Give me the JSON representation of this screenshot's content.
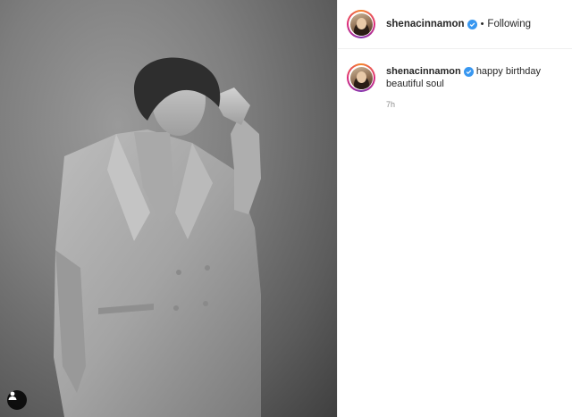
{
  "post": {
    "author": "shenacinnamon",
    "follow_status": "Following",
    "separator": "•",
    "caption_author": "shenacinnamon",
    "caption_text": "happy birthday beautiful soul",
    "timestamp": "7h",
    "photo": "black-and-white portrait of a person in a double-breasted suit, hand raised to hair"
  },
  "icons": {
    "verified": "verified-badge-icon",
    "tagged_users": "user-tag-icon"
  },
  "colors": {
    "verified_blue": "#3897f0",
    "border": "#efefef",
    "muted_text": "#8e8e8e"
  }
}
